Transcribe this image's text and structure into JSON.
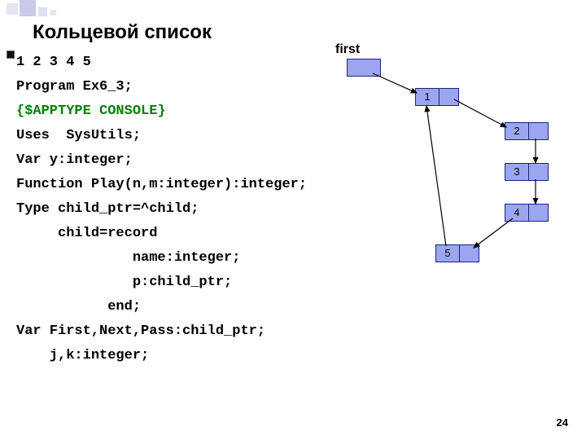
{
  "title": "Кольцевой список",
  "page_number": "24",
  "code_lines": [
    {
      "text": "1 2 3 4 5",
      "cls": ""
    },
    {
      "text": "Program Ex6_3;",
      "cls": ""
    },
    {
      "text": "{$APPTYPE CONSOLE}",
      "cls": "green"
    },
    {
      "text": "Uses  SysUtils;",
      "cls": ""
    },
    {
      "text": "Var y:integer;",
      "cls": ""
    },
    {
      "text": "Function Play(n,m:integer):integer;",
      "cls": ""
    },
    {
      "text": "Type child_ptr=^child;",
      "cls": ""
    },
    {
      "text": "     child=record",
      "cls": ""
    },
    {
      "text": "              name:integer;",
      "cls": ""
    },
    {
      "text": "              p:child_ptr;",
      "cls": ""
    },
    {
      "text": "           end;",
      "cls": ""
    },
    {
      "text": "Var First,Next,Pass:child_ptr;",
      "cls": ""
    },
    {
      "text": "    j,k:integer;",
      "cls": ""
    }
  ],
  "diagram": {
    "first_label": "first",
    "nodes": [
      {
        "value": "1"
      },
      {
        "value": "2"
      },
      {
        "value": "3"
      },
      {
        "value": "4"
      },
      {
        "value": "5"
      }
    ]
  }
}
